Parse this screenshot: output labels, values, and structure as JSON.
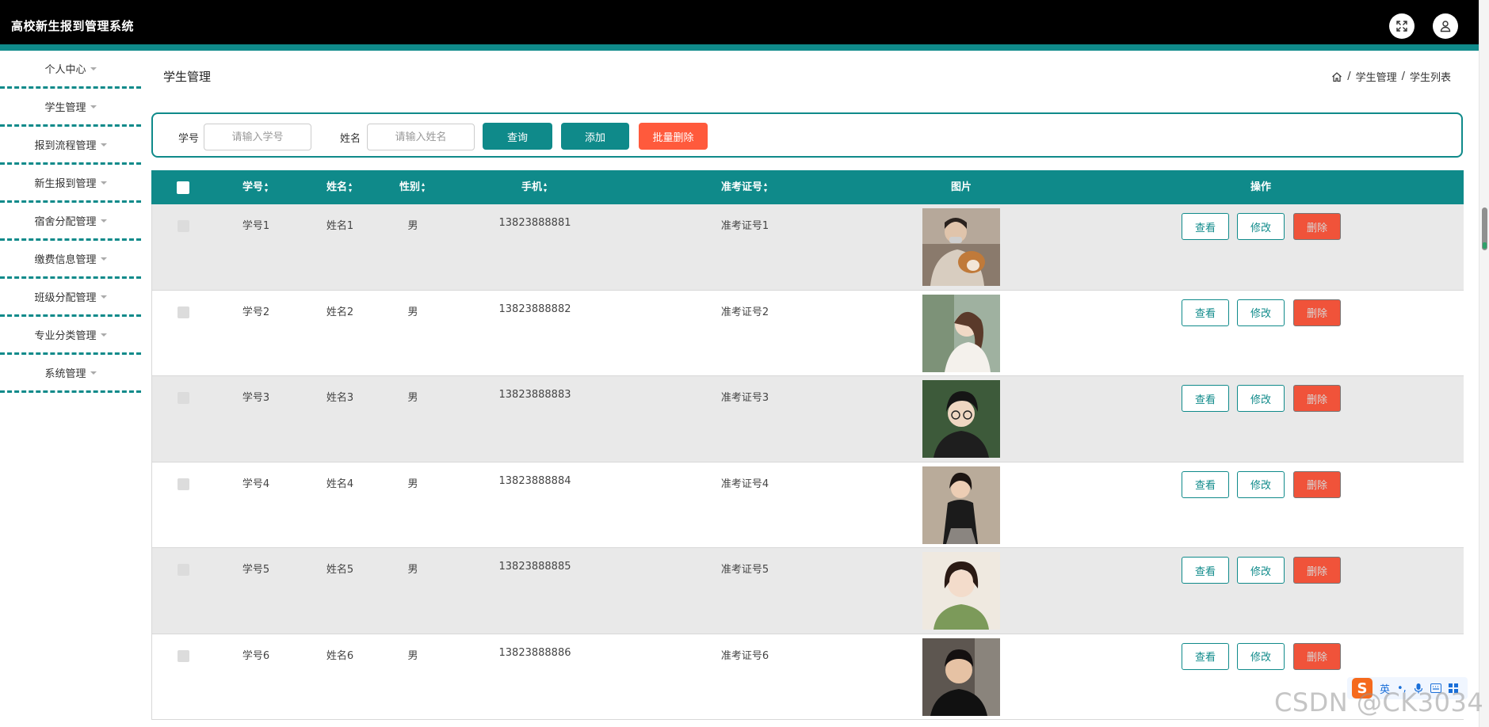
{
  "app": {
    "title": "高校新生报到管理系统"
  },
  "icons": {
    "fullscreen": "expand-icon",
    "user": "user-icon",
    "home": "home-icon"
  },
  "colors": {
    "primary": "#0f8a8a",
    "danger": "#ff5a3c",
    "topbar": "#000000"
  },
  "sidebar": {
    "items": [
      {
        "label": "个人中心"
      },
      {
        "label": "学生管理"
      },
      {
        "label": "报到流程管理"
      },
      {
        "label": "新生报到管理"
      },
      {
        "label": "宿舍分配管理"
      },
      {
        "label": "缴费信息管理"
      },
      {
        "label": "班级分配管理"
      },
      {
        "label": "专业分类管理"
      },
      {
        "label": "系统管理"
      }
    ]
  },
  "page": {
    "title": "学生管理",
    "breadcrumb": [
      "学生管理",
      "学生列表"
    ],
    "breadcrumb_sep": "/"
  },
  "search": {
    "xuehao_label": "学号",
    "xuehao_placeholder": "请输入学号",
    "xingming_label": "姓名",
    "xingming_placeholder": "请输入姓名",
    "query_button": "查询",
    "add_button": "添加",
    "batch_delete_button": "批量删除"
  },
  "table": {
    "columns": [
      "学号",
      "姓名",
      "性别",
      "手机",
      "准考证号",
      "图片",
      "操作"
    ],
    "rows": [
      {
        "xuehao": "学号1",
        "xingming": "姓名1",
        "xingbie": "男",
        "shouji": "13823888881",
        "zhunkaozheng": "准考证号1"
      },
      {
        "xuehao": "学号2",
        "xingming": "姓名2",
        "xingbie": "男",
        "shouji": "13823888882",
        "zhunkaozheng": "准考证号2"
      },
      {
        "xuehao": "学号3",
        "xingming": "姓名3",
        "xingbie": "男",
        "shouji": "13823888883",
        "zhunkaozheng": "准考证号3"
      },
      {
        "xuehao": "学号4",
        "xingming": "姓名4",
        "xingbie": "男",
        "shouji": "13823888884",
        "zhunkaozheng": "准考证号4"
      },
      {
        "xuehao": "学号5",
        "xingming": "姓名5",
        "xingbie": "男",
        "shouji": "13823888885",
        "zhunkaozheng": "准考证号5"
      },
      {
        "xuehao": "学号6",
        "xingming": "姓名6",
        "xingbie": "男",
        "shouji": "13823888886",
        "zhunkaozheng": "准考证号6"
      }
    ],
    "actions": {
      "view": "查看",
      "edit": "修改",
      "delete": "删除"
    }
  },
  "overlay": {
    "ime_mode": "英",
    "watermark": "CSDN @CK3034"
  }
}
